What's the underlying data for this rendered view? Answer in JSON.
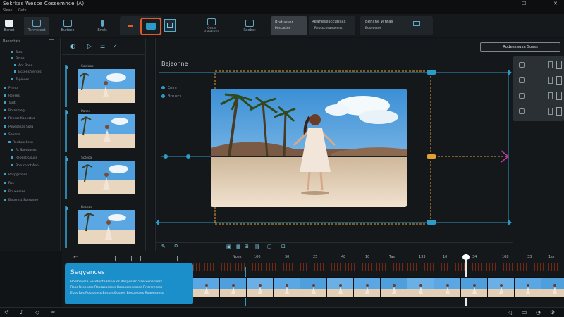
{
  "window": {
    "title": "Sekrkas Wesce Cossemnce (A)",
    "controls": [
      "—",
      "☐",
      "✕"
    ]
  },
  "menubar": [
    "Sleas",
    "Gets"
  ],
  "toolbar": {
    "buttons": [
      {
        "label": "Benet",
        "icon": "film-icon"
      },
      {
        "label": "Tenvecast",
        "icon": "clip-icon"
      },
      {
        "label": "Buitece",
        "icon": "layout-icon"
      },
      {
        "label": "Bncls",
        "icon": "grid-icon"
      },
      {
        "label": "",
        "icon": "record-icon"
      },
      {
        "label": "",
        "icon": "effects-icon"
      },
      {
        "label": "",
        "icon": "monitor-icon"
      },
      {
        "label": "Ouca\nRabrkisss",
        "icon": "screen-icon"
      },
      {
        "label": "Roobct",
        "icon": "audio-icon"
      }
    ],
    "group1": {
      "title": "Roduesor",
      "sub": "Pescacine"
    },
    "group2": {
      "title": "Reanesesccunsas",
      "sub": "Reosscesanocens"
    },
    "group3": {
      "title": "Bensne Wntas",
      "sub": "Bossesses"
    }
  },
  "left_panel": {
    "header": "Ransntats",
    "items": [
      "Bois",
      "Bctes",
      "Aot Bonn",
      "Bcsens Sentes",
      "Tapinoss",
      "Phmts",
      "Roeses",
      "Tarit",
      "Botosmeg",
      "Reesss Kauestos",
      "Pouesesas Sorg",
      "Seeans",
      "Reutuuehrsu",
      "Rt Saeutuses",
      "Reoess Gsuss",
      "Bosurnsnt Aen",
      "Rospgsrsies",
      "Rss",
      "Rpueruses",
      "Bausmst Sorsonne"
    ]
  },
  "thumbnails": [
    {
      "label": "Saeioas"
    },
    {
      "label": "Panes"
    },
    {
      "label": "Scteca"
    },
    {
      "label": "Bacsuo"
    }
  ],
  "viewer": {
    "title": "Bejeonne",
    "items": [
      "Enjm",
      "Brsuscs"
    ]
  },
  "right_panel": {
    "inspector_label": "Rodessausa Sosss"
  },
  "timeline": {
    "ruler_labels": [
      "Noes",
      "100",
      "30",
      "25",
      "48",
      "10",
      "Tas",
      "133",
      "10",
      "34",
      "108",
      "33",
      "1ss"
    ],
    "current_marker": "play-head"
  },
  "info_card": {
    "title": "Seqyences",
    "lines": [
      "Bo Rosessa Sasetenta Ransuos Raspesotn Saesesnasaess",
      "Rass Rssesese Rossasasesss Rossussesessse Rnorsresess",
      "Eoss Res Rossosess Bossss Bosues Bosooeaes Roaoosaess"
    ]
  },
  "status_icons": [
    "undo-icon",
    "audio-icon",
    "trim-icon",
    "cut-icon"
  ],
  "colors": {
    "accent": "#2d9bc6",
    "panel": "#15181b",
    "marker": "#e1a130",
    "record": "#e05a2b"
  }
}
